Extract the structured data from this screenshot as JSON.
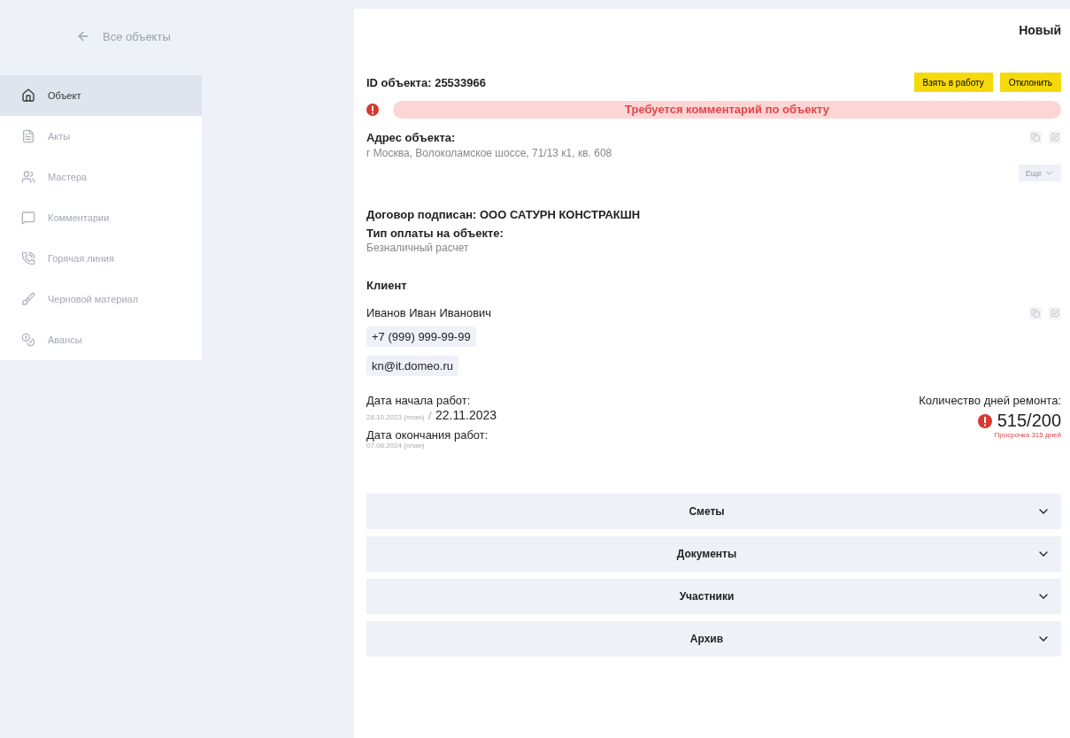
{
  "back_link": "Все объекты",
  "sidebar": {
    "items": [
      {
        "label": "Объект",
        "selected": true
      },
      {
        "label": "Акты",
        "selected": false
      },
      {
        "label": "Мастера",
        "selected": false
      },
      {
        "label": "Комментарии",
        "selected": false
      },
      {
        "label": "Горячая линия",
        "selected": false
      },
      {
        "label": "Черновой материал",
        "selected": false
      },
      {
        "label": "Авансы",
        "selected": false
      }
    ]
  },
  "status": "Новый",
  "object_id": "ID объекта: 25533966",
  "actions": [
    "Взять в работу",
    "Отклонить"
  ],
  "alert": "Требуется комментарий по объекту",
  "address": {
    "label": "Адрес объекта:",
    "value": "г Москва, Волоколамское шоссе, 71/13 к1, кв. 608"
  },
  "more_button": "Еще",
  "contract": "Договор подписан: ООО САТУРН КОНСТРАКШН",
  "payment": {
    "label": "Тип оплаты на объекте:",
    "value": "Безналичный расчет"
  },
  "client": {
    "heading": "Клиент",
    "name": "Иванов Иван Иванович",
    "phone": "+7 (999) 999-99-99",
    "email": "kn@it.domeo.ru"
  },
  "start": {
    "label": "Дата начала работ:",
    "plan": "28.10.2023 (план)",
    "separator": "/",
    "actual": "22.11.2023"
  },
  "end": {
    "label": "Дата окончания работ:",
    "plan": "07.08.2024 (план)"
  },
  "repair_days": {
    "label": "Количество дней ремонта:",
    "value": "515/200",
    "overdue": "Просрочка 315 дней"
  },
  "sections": [
    {
      "title": "Сметы",
      "expanded": false
    },
    {
      "title": "Документы",
      "expanded": false
    },
    {
      "title": "Участники",
      "expanded": false
    },
    {
      "title": "Архив",
      "expanded": false
    }
  ]
}
